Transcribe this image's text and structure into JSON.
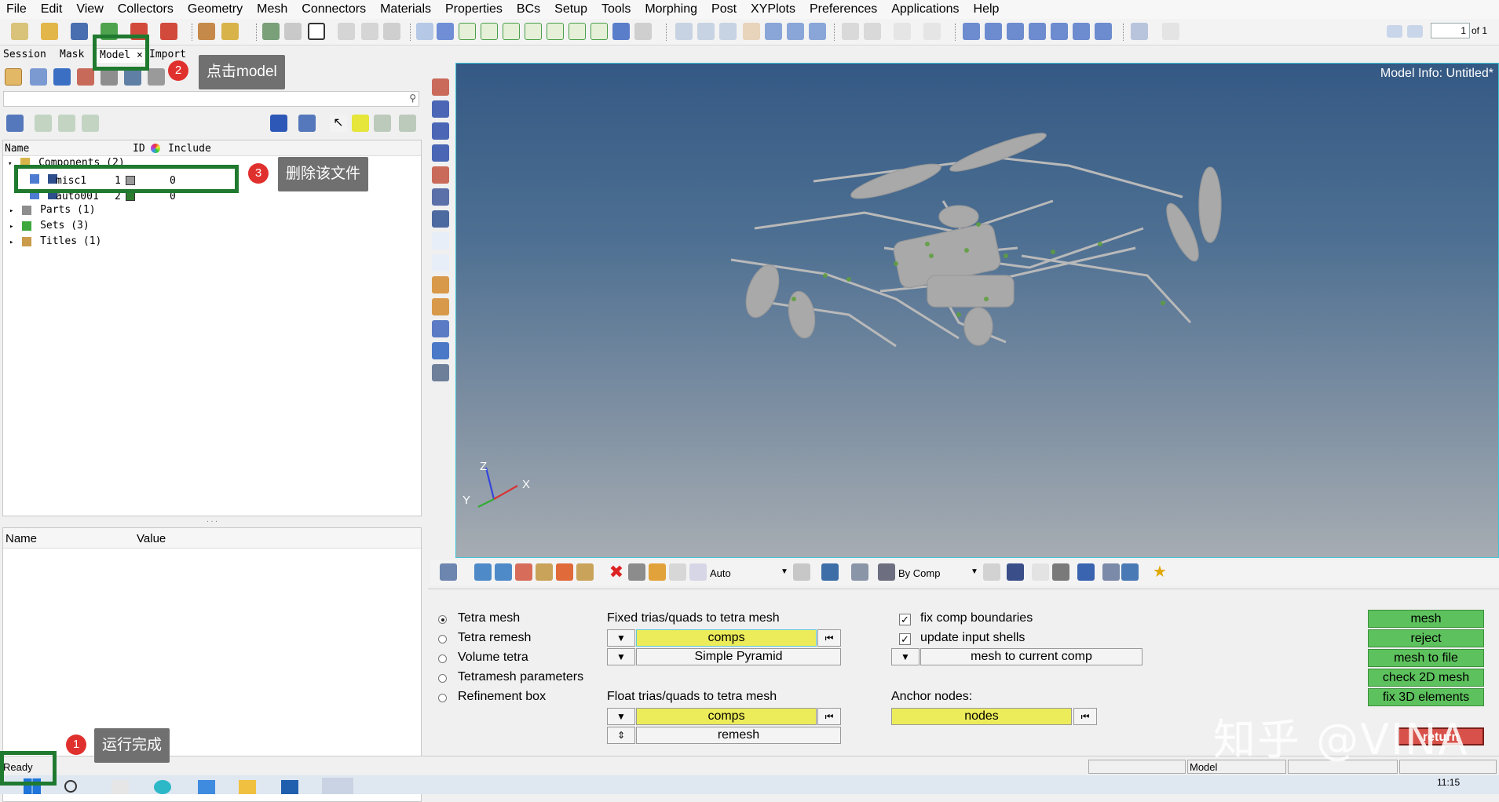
{
  "menu": [
    "File",
    "Edit",
    "View",
    "Collectors",
    "Geometry",
    "Mesh",
    "Connectors",
    "Materials",
    "Properties",
    "BCs",
    "Setup",
    "Tools",
    "Morphing",
    "Post",
    "XYPlots",
    "Preferences",
    "Applications",
    "Help"
  ],
  "page_nav": {
    "current": "1",
    "of": "of 1"
  },
  "tabs": {
    "session": "Session",
    "mask": "Mask",
    "model": "Model ×",
    "import": "Import"
  },
  "tree": {
    "headers": {
      "name": "Name",
      "id": "ID",
      "include": "Include"
    },
    "components": "Components (2)",
    "misc1": {
      "name": "misc1",
      "id": "1",
      "include": "0"
    },
    "auto001": {
      "name": "auto001",
      "id": "2",
      "include": "0"
    },
    "parts": "Parts (1)",
    "sets": "Sets (3)",
    "titles": "Titles (1)"
  },
  "props": {
    "name": "Name",
    "value": "Value"
  },
  "viewport": {
    "model_info": "Model Info: Untitled*",
    "axis_z": "Z",
    "axis_x": "X",
    "axis_y": "Y"
  },
  "bottom_toolbar": {
    "auto": "Auto",
    "by_comp": "By Comp"
  },
  "panel": {
    "radios": [
      "Tetra mesh",
      "Tetra remesh",
      "Volume tetra",
      "Tetramesh parameters",
      "Refinement box"
    ],
    "fixed_label": "Fixed trias/quads to tetra mesh",
    "fixed_comps": "comps",
    "simple_pyramid": "Simple Pyramid",
    "float_label": "Float trias/quads to tetra mesh",
    "float_comps": "comps",
    "remesh": "remesh",
    "fix_comp_boundaries": "fix comp boundaries",
    "update_input_shells": "update input shells",
    "mesh_to_current_comp": "mesh to current comp",
    "anchor_label": "Anchor nodes:",
    "nodes": "nodes",
    "buttons": [
      "mesh",
      "reject",
      "mesh to file",
      "check 2D mesh",
      "fix 3D elements"
    ],
    "return": "return"
  },
  "status": {
    "ready": "Ready",
    "model": "Model"
  },
  "taskbar": {
    "clock": "11:15"
  },
  "annotations": [
    {
      "num": "1",
      "label": "运行完成"
    },
    {
      "num": "2",
      "label": "点击model"
    },
    {
      "num": "3",
      "label": "删除该文件"
    }
  ],
  "watermark": "知乎 @VINA",
  "colors": {
    "annotation_box": "#1f7a2f",
    "annotation_dot": "#e0302d",
    "green_button": "#5dc25d",
    "yellow_button": "#ecec5a",
    "viewport_border": "#3fc5d6",
    "auto001_color": "#2e7d2e",
    "misc1_color": "#9a9a9a"
  }
}
